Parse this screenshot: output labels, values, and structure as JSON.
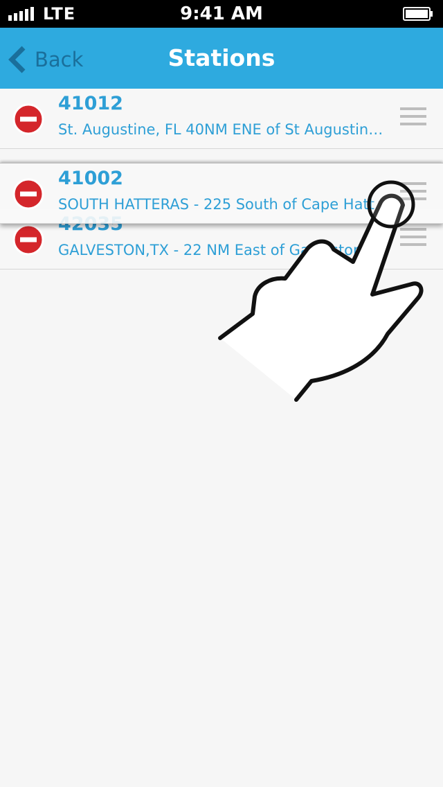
{
  "status_bar": {
    "carrier": "LTE",
    "time": "9:41 AM"
  },
  "nav": {
    "back_label": "Back",
    "title": "Stations"
  },
  "stations": [
    {
      "id": "41012",
      "description": "St. Augustine, FL 40NM ENE of St Augustine,…"
    },
    {
      "id": "42035",
      "description": "GALVESTON,TX -  22 NM East of Galveston"
    },
    {
      "id": "41002",
      "description": "SOUTH HATTERAS - 225 South of Cape Hatteras"
    }
  ],
  "colors": {
    "accent": "#2eaadf",
    "text_blue": "#2e9fd6",
    "delete_red": "#d4262b"
  }
}
